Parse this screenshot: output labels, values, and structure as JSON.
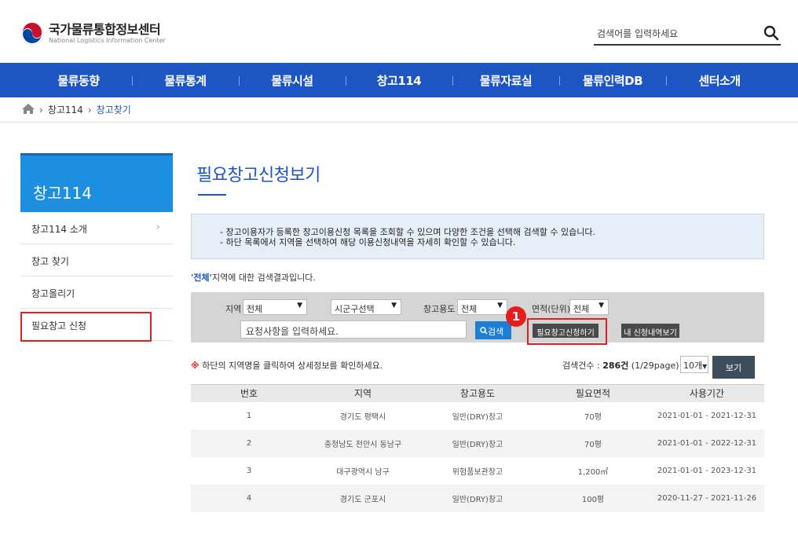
{
  "header": {
    "logo_kr": "국가물류통합정보센터",
    "logo_en": "National Logistics Information Center",
    "search_placeholder": "검색어를 입력하세요"
  },
  "nav": [
    "물류동향",
    "물류통계",
    "물류시설",
    "창고114",
    "물류자료실",
    "물류인력DB",
    "센터소개"
  ],
  "breadcrumb": {
    "level1": "창고114",
    "level2": "창고찾기"
  },
  "sidebar": {
    "title": "창고114",
    "items": [
      "창고114 소개",
      "창고 찾기",
      "창고올리기",
      "필요창고 신청"
    ]
  },
  "page_title": "필요창고신청보기",
  "info": [
    "- 창고이용자가 등록한 창고이용신청 목록을 조회할 수 있으며 다양한 조건을 선택해 검색할 수 있습니다.",
    "- 하단 목록에서 지역을 선택하여 해당 이용신청내역을 자세히 확인할 수 있습니다."
  ],
  "result": {
    "region": "'전체'",
    "suffix": "지역에 대한 검색결과입니다."
  },
  "filter": {
    "region_label": "지역",
    "region_value": "전체",
    "district_value": "시군구선택",
    "usage_label": "창고용도",
    "usage_value": "전체",
    "area_label": "면적(단위)",
    "area_value": "전체",
    "request_placeholder": "요청사항을 입력하세요.",
    "search_label": "검색",
    "apply_label": "필요창고신청하기",
    "mine_label": "내 신청내역보기"
  },
  "marker": "1",
  "note": {
    "star": "※",
    "text": " 하단의 지역명을 클릭하여 상세정보를 확인하세요."
  },
  "count": {
    "label": "검색건수 : ",
    "value": "286건",
    "page": " (1/29page)"
  },
  "per_page": "10개",
  "view_label": "보기",
  "table": {
    "headers": [
      "번호",
      "지역",
      "창고용도",
      "필요면적",
      "사용기간"
    ],
    "rows": [
      [
        "1",
        "경기도 평택시",
        "일반(DRY)창고",
        "70평",
        "2021-01-01 - 2021-12-31"
      ],
      [
        "2",
        "충청남도 천안시 동남구",
        "일반(DRY)창고",
        "70평",
        "2021-01-01 - 2022-12-31"
      ],
      [
        "3",
        "대구광역시 남구",
        "위험품보관창고",
        "1,200㎡",
        "2021-01-01 - 2023-12-31"
      ],
      [
        "4",
        "경기도 군포시",
        "일반(DRY)창고",
        "100평",
        "2020-11-27 - 2021-11-26"
      ]
    ]
  },
  "colors": {
    "nav_blue": "#1d56c3",
    "side_blue": "#1d8fe0",
    "highlight_red": "#e51d1d"
  },
  "icons": {
    "home": "home-icon",
    "search": "search-icon",
    "chevron": "chevron-right-icon"
  }
}
